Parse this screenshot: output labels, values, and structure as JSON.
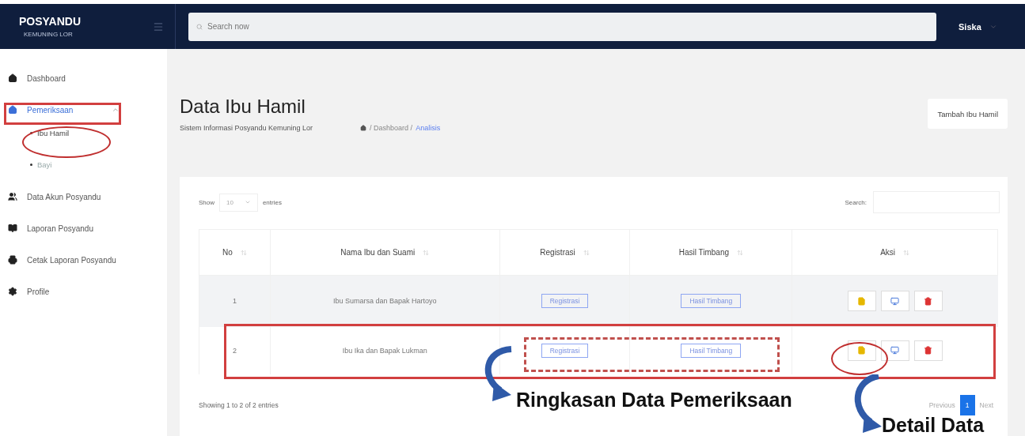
{
  "brand": {
    "title": "POSYANDU",
    "subtitle": "KEMUNING LOR"
  },
  "topbar": {
    "search": {
      "placeholder": "Search now"
    },
    "user": "Siska"
  },
  "sidebar": {
    "items": [
      {
        "label": "Dashboard",
        "selected": false
      },
      {
        "label": "Pemeriksaan",
        "selected": true,
        "expanded": true,
        "children": [
          {
            "label": "Ibu Hamil",
            "selected": true
          },
          {
            "label": "Bayi",
            "selected": false
          }
        ]
      },
      {
        "label": "Data Akun Posyandu",
        "selected": false
      },
      {
        "label": "Laporan Posyandu",
        "selected": false
      },
      {
        "label": "Cetak Laporan Posyandu",
        "selected": false
      },
      {
        "label": "Profile",
        "selected": false
      }
    ]
  },
  "page": {
    "title": "Data Ibu Hamil",
    "subtitle": "Sistem Informasi Posyandu Kemuning Lor",
    "breadcrumb": [
      "/ Dashboard /",
      "Analisis"
    ],
    "add_button": "Tambah Ibu Hamil"
  },
  "table_controls": {
    "show": "Show",
    "entries_value": "10",
    "entries": "entries",
    "search_label": "Search:"
  },
  "table": {
    "columns": [
      "No",
      "Nama Ibu dan Suami",
      "Registrasi",
      "Hasil Timbang",
      "Aksi"
    ],
    "rows": [
      {
        "no": "1",
        "name": "Ibu Sumarsa dan Bapak Hartoyo",
        "registrasi": "Registrasi",
        "hasil": "Hasil Timbang"
      },
      {
        "no": "2",
        "name": "Ibu Ika dan Bapak Lukman",
        "registrasi": "Registrasi",
        "hasil": "Hasil Timbang"
      }
    ]
  },
  "footer": {
    "info": "Showing 1 to 2 of 2 entries",
    "pages": [
      {
        "label": "Previous",
        "selected": false
      },
      {
        "label": "1",
        "selected": true
      },
      {
        "label": "Next",
        "selected": false
      }
    ]
  },
  "annotations": [
    {
      "text": "Ringkasan Data Pemeriksaan"
    },
    {
      "text": "Detail Data"
    }
  ]
}
